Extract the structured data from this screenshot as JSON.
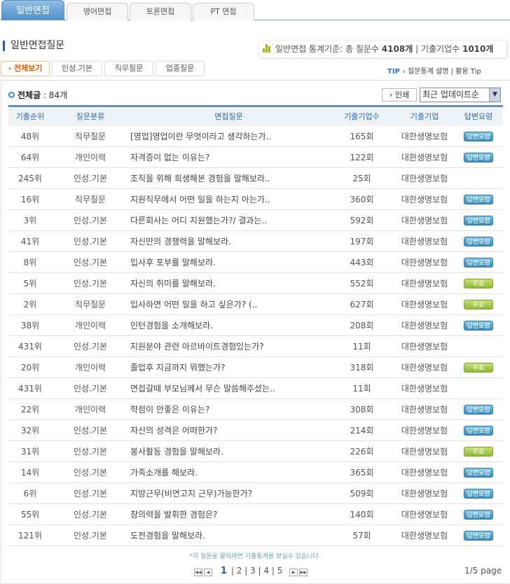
{
  "tabs": [
    "일반면접",
    "영어면접",
    "토론면접",
    "PT 면접"
  ],
  "title": "일반면접질문",
  "stats": {
    "label": "일반면접 통계기준: 총 질문수",
    "questions": "4108개",
    "sep": "| 기출기업수",
    "companies": "1010개"
  },
  "subtabs": [
    "전체보기",
    "인성.기본",
    "직무질문",
    "업종질문"
  ],
  "tip": {
    "label": "TIP",
    "links": "› 질문통계 설명 | 활용 Tip"
  },
  "count": {
    "label": "전체글",
    "value": ": 84개"
  },
  "print_label": "인쇄",
  "sort": {
    "selected": "최근 업데이트순"
  },
  "columns": [
    "기출순위",
    "질문분류",
    "면접질문",
    "기출기업수",
    "기출기업",
    "답변요령"
  ],
  "badges": {
    "tip": "답변요령",
    "free": "무료"
  },
  "rows": [
    [
      "48위",
      "직무질문",
      "[영업]영업이란 무엇이라고 생각하는가..",
      "165회",
      "대한생명보험",
      "tip"
    ],
    [
      "64위",
      "개인이력",
      "자격증이 없는 이유는?",
      "122회",
      "대한생명보험",
      "tip"
    ],
    [
      "245위",
      "인성.기본",
      "조직을 위해 희생해본 경험을 말해보라..",
      "25회",
      "대한생명보험",
      ""
    ],
    [
      "16위",
      "직무질문",
      "지원직무에서 어떤 일을 하는지 아는가..",
      "360회",
      "대한생명보험",
      "tip"
    ],
    [
      "3위",
      "인성.기본",
      "다른회사는 어디 지원했는가?/ 결과는..",
      "592회",
      "대한생명보험",
      "tip"
    ],
    [
      "41위",
      "인성.기본",
      "자신만의 경쟁력을 말해보라.",
      "197회",
      "대한생명보험",
      "tip"
    ],
    [
      "8위",
      "인성.기본",
      "입사후 포부를 말해보라.",
      "443회",
      "대한생명보험",
      "tip"
    ],
    [
      "5위",
      "인성.기본",
      "자신의 취미를 말해보라.",
      "552회",
      "대한생명보험",
      "free"
    ],
    [
      "2위",
      "직무질문",
      "입사하면 어떤 일을 하고 싶은가? (..",
      "627회",
      "대한생명보험",
      "free"
    ],
    [
      "38위",
      "개인이력",
      "인턴경험을 소개해보라.",
      "208회",
      "대한생명보험",
      "tip"
    ],
    [
      "431위",
      "인성.기본",
      "지원분야 관련 아르바이트경험있는가?",
      "11회",
      "대한생명보험",
      ""
    ],
    [
      "20위",
      "개인이력",
      "졸업후 지금까지 뭐했는가?",
      "318회",
      "대한생명보험",
      "free"
    ],
    [
      "431위",
      "인성.기본",
      "면접갈때 부모님께서 무슨 말씀해주셨는..",
      "11회",
      "대한생명보험",
      ""
    ],
    [
      "22위",
      "개인이력",
      "학점이 안좋은 이유는?",
      "308회",
      "대한생명보험",
      "tip"
    ],
    [
      "32위",
      "인성.기본",
      "자신의 성격은 어떠한가?",
      "214회",
      "대한생명보험",
      "tip"
    ],
    [
      "31위",
      "인성.기본",
      "봉사활동 경험을 말해보라.",
      "226회",
      "대한생명보험",
      "free"
    ],
    [
      "14위",
      "인성.기본",
      "가족소개를 해보라.",
      "365회",
      "대한생명보험",
      "tip"
    ],
    [
      "6위",
      "인성.기본",
      "지방근무(비연고지 근무)가능한가?",
      "509회",
      "대한생명보험",
      "tip"
    ],
    [
      "55위",
      "인성.기본",
      "창의력을 발휘한 경험은?",
      "140회",
      "대한생명보험",
      "tip"
    ],
    [
      "121위",
      "인성.기본",
      "도전경험을 말해보라.",
      "57회",
      "대한생명보험",
      "tip"
    ]
  ],
  "note": "*각 질문을 클릭하면 기출통계를 보실수 있습니다.",
  "pager": {
    "current": "1",
    "pages": [
      "2",
      "3",
      "4",
      "5"
    ],
    "info": "1/5 page"
  }
}
